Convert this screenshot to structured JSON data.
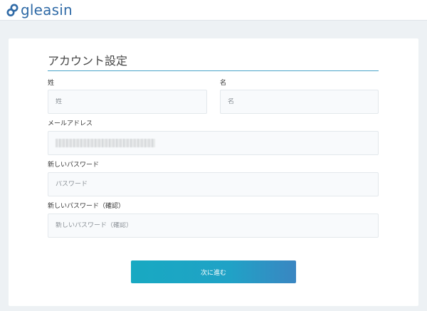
{
  "header": {
    "logo_text": "gleasin",
    "logo_icon": "gleasin-logo-icon"
  },
  "form": {
    "title": "アカウント設定",
    "last_name": {
      "label": "姓",
      "placeholder": "姓",
      "value": ""
    },
    "first_name": {
      "label": "名",
      "placeholder": "名",
      "value": ""
    },
    "email": {
      "label": "メールアドレス",
      "value_redacted": true
    },
    "new_password": {
      "label": "新しいパスワード",
      "placeholder": "パスワード",
      "value": ""
    },
    "confirm_password": {
      "label": "新しいパスワード（確認）",
      "placeholder": "新しいパスワード（確認）",
      "value": ""
    },
    "submit_label": "次に進む"
  },
  "colors": {
    "brand": "#2f6aa6",
    "accent": "#1aa8c2",
    "background": "#edf1f4"
  }
}
